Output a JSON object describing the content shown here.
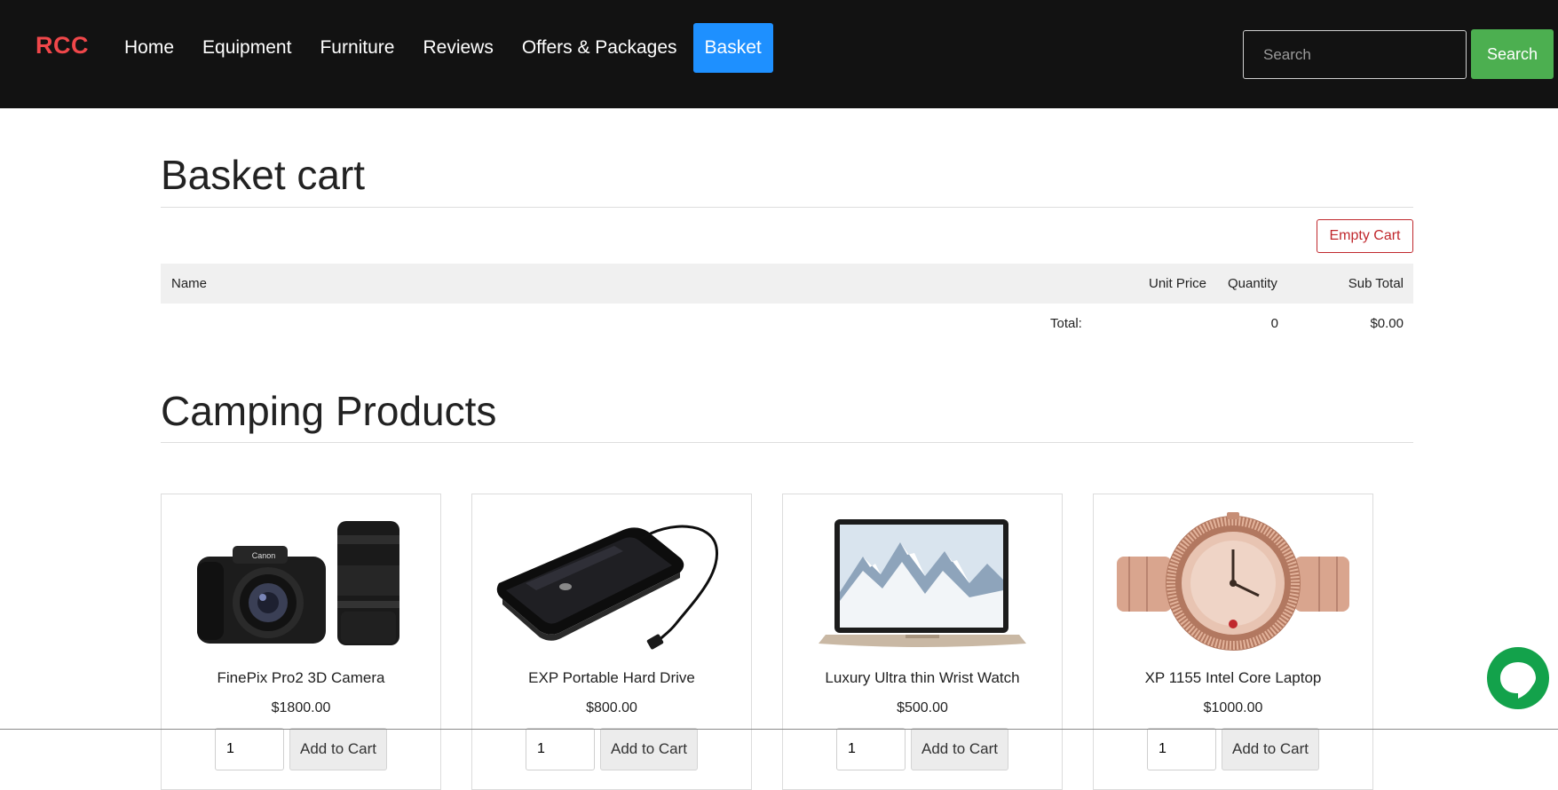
{
  "navbar": {
    "brand": "RCC",
    "links": [
      {
        "label": "Home"
      },
      {
        "label": "Equipment"
      },
      {
        "label": "Furniture"
      },
      {
        "label": "Reviews"
      },
      {
        "label": "Offers & Packages"
      },
      {
        "label": "Basket",
        "active": true
      }
    ],
    "search": {
      "placeholder": "Search",
      "button_label": "Search"
    }
  },
  "basket": {
    "title": "Basket cart",
    "empty_cart_label": "Empty Cart",
    "columns": {
      "name": "Name",
      "unit_price": "Unit Price",
      "quantity": "Quantity",
      "sub_total": "Sub Total"
    },
    "total": {
      "label": "Total:",
      "quantity": "0",
      "amount": "$0.00"
    }
  },
  "products": {
    "title": "Camping Products",
    "items": [
      {
        "name": "FinePix Pro2 3D Camera",
        "price": "$1800.00",
        "qty": "1",
        "button": "Add to Cart",
        "image_icon": "camera-icon"
      },
      {
        "name": "EXP Portable Hard Drive",
        "price": "$800.00",
        "qty": "1",
        "button": "Add to Cart",
        "image_icon": "hard-drive-icon"
      },
      {
        "name": "Luxury Ultra thin Wrist Watch",
        "price": "$500.00",
        "qty": "1",
        "button": "Add to Cart",
        "image_icon": "laptop-icon"
      },
      {
        "name": "XP 1155 Intel Core Laptop",
        "price": "$1000.00",
        "qty": "1",
        "button": "Add to Cart",
        "image_icon": "watch-icon"
      }
    ]
  },
  "colors": {
    "navbar_bg": "#121212",
    "brand": "#f0474a",
    "active_link": "#1e90ff",
    "search_button": "#4caf50",
    "empty_cart": "#c0282d",
    "chat": "#13a24b"
  },
  "chat": {
    "icon": "chat-icon"
  }
}
